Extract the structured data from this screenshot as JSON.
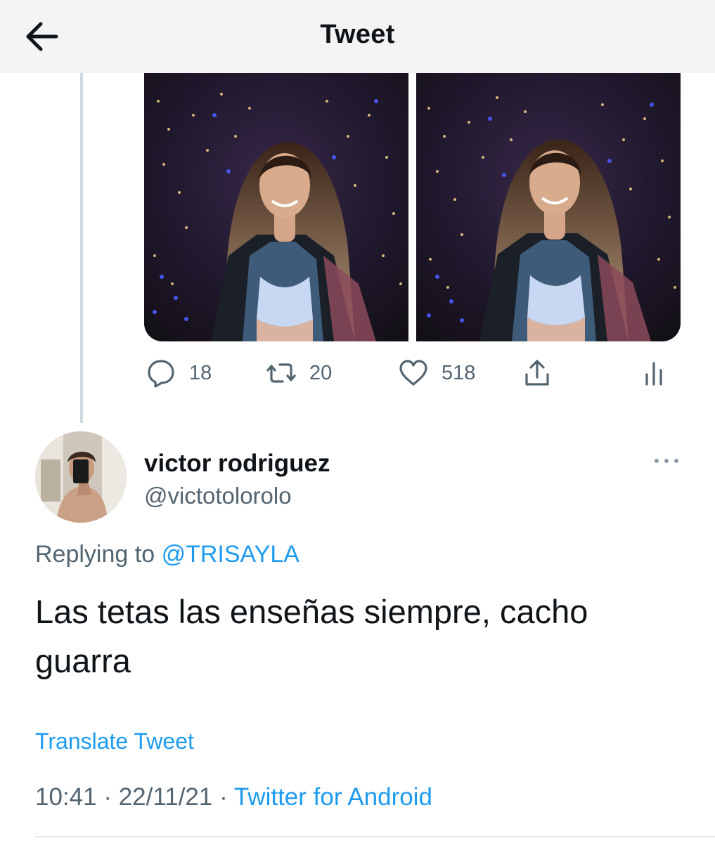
{
  "header": {
    "title": "Tweet",
    "back_icon": "arrow-left-icon"
  },
  "parent_tweet": {
    "images": [
      "photo-left",
      "photo-right"
    ],
    "actions": {
      "replies": "18",
      "retweets": "20",
      "likes": "518"
    }
  },
  "reply_tweet": {
    "author": {
      "name": "victor rodriguez",
      "handle": "@victotolorolo"
    },
    "replying_label": "Replying to",
    "replying_to": "@TRISAYLA",
    "text": "Las tetas las enseñas siempre, cacho guarra",
    "translate_label": "Translate Tweet",
    "time": "10:41",
    "separator": "·",
    "date": "22/11/21",
    "source": "Twitter for Android"
  },
  "colors": {
    "accent": "#1d9bf0",
    "secondary_text": "#536471",
    "primary_text": "#0f1419",
    "header_bg": "#f4f4f4",
    "thread_line": "#cfd9de"
  }
}
